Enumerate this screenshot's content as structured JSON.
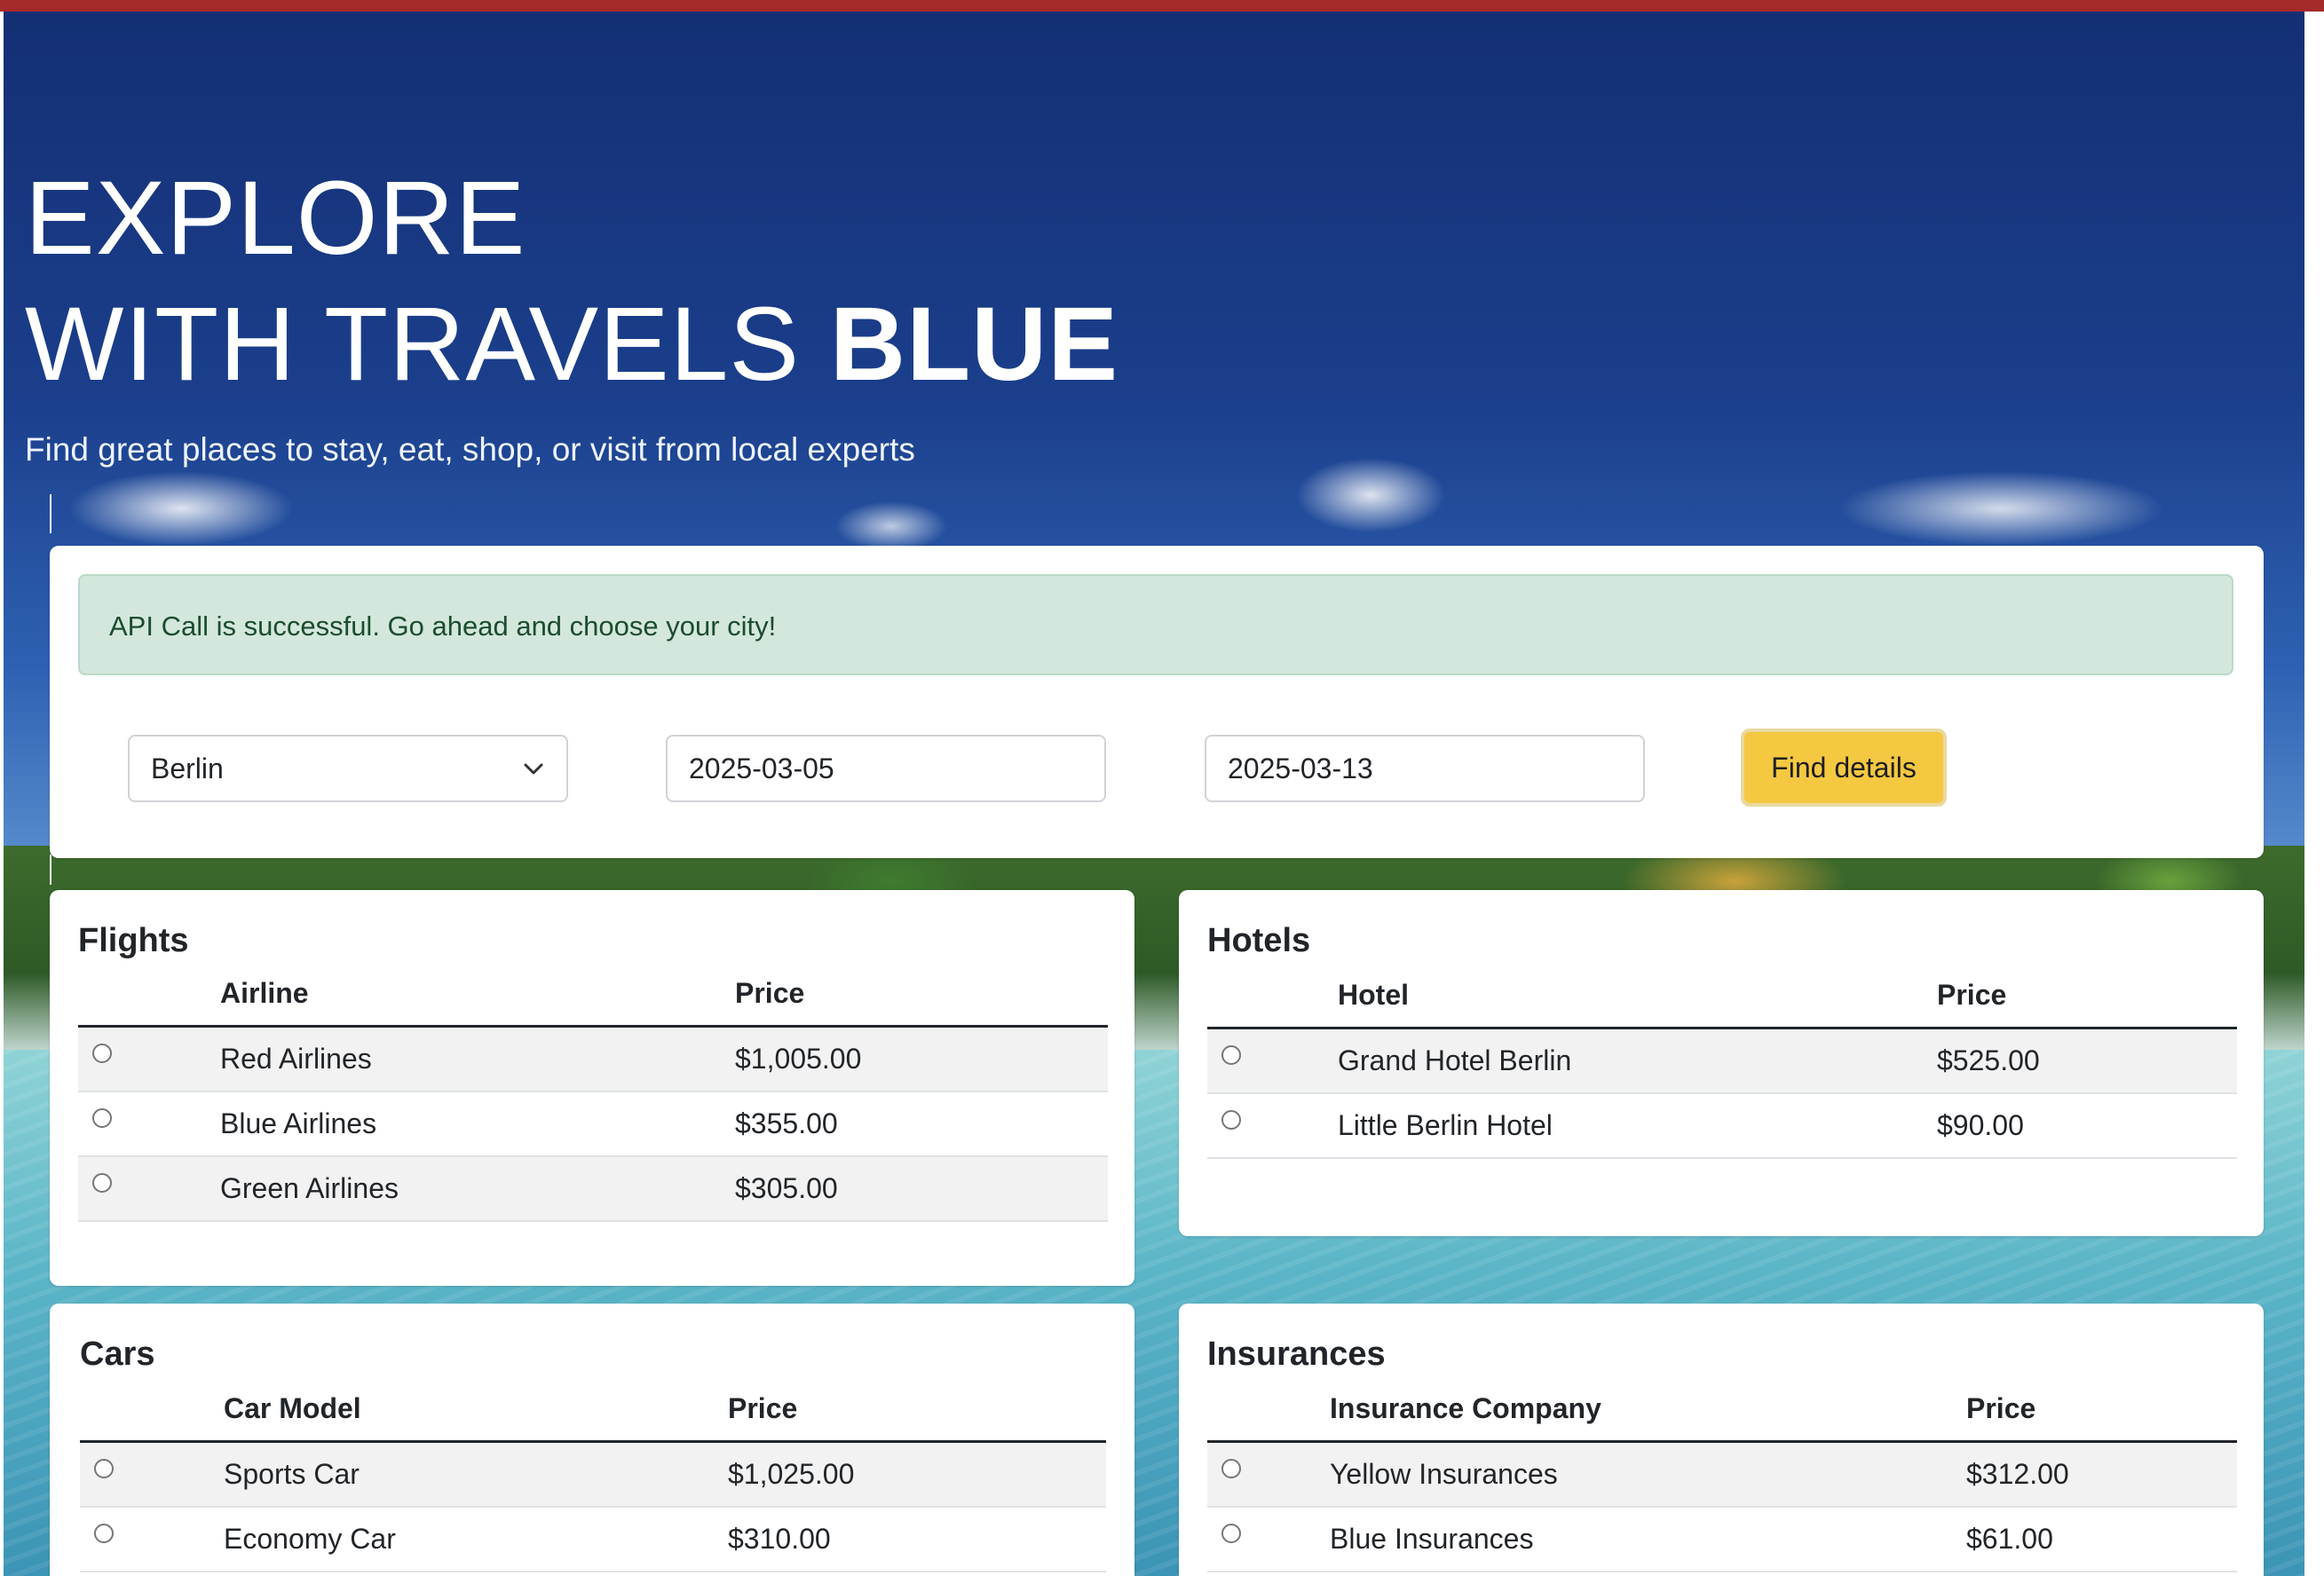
{
  "hero": {
    "title_line1": "EXPLORE",
    "title_line2_light": "WITH TRAVELS ",
    "title_line2_bold": "BLUE",
    "subtitle": "Find great places to stay, eat, shop, or visit from local experts"
  },
  "alert": {
    "message": "API Call is successful. Go ahead and choose your city!"
  },
  "search": {
    "city": "Berlin",
    "start_date": "2025-03-05",
    "end_date": "2025-03-13",
    "find_label": "Find details"
  },
  "flights": {
    "title": "Flights",
    "headers": [
      "Airline",
      "Price"
    ],
    "rows": [
      {
        "name": "Red Airlines",
        "price": "$1,005.00"
      },
      {
        "name": "Blue Airlines",
        "price": "$355.00"
      },
      {
        "name": "Green Airlines",
        "price": "$305.00"
      }
    ]
  },
  "hotels": {
    "title": "Hotels",
    "headers": [
      "Hotel",
      "Price"
    ],
    "rows": [
      {
        "name": "Grand Hotel Berlin",
        "price": "$525.00"
      },
      {
        "name": "Little Berlin Hotel",
        "price": "$90.00"
      }
    ]
  },
  "cars": {
    "title": "Cars",
    "headers": [
      "Car Model",
      "Price"
    ],
    "rows": [
      {
        "name": "Sports Car",
        "price": "$1,025.00"
      },
      {
        "name": "Economy Car",
        "price": "$310.00"
      }
    ]
  },
  "insurances": {
    "title": "Insurances",
    "headers": [
      "Insurance Company",
      "Price"
    ],
    "rows": [
      {
        "name": "Yellow Insurances",
        "price": "$312.00"
      },
      {
        "name": "Blue Insurances",
        "price": "$61.00"
      }
    ]
  },
  "colors": {
    "top_bar": "#a52a2a",
    "button": "#f5c842",
    "alert_bg": "#d4e7dd"
  }
}
